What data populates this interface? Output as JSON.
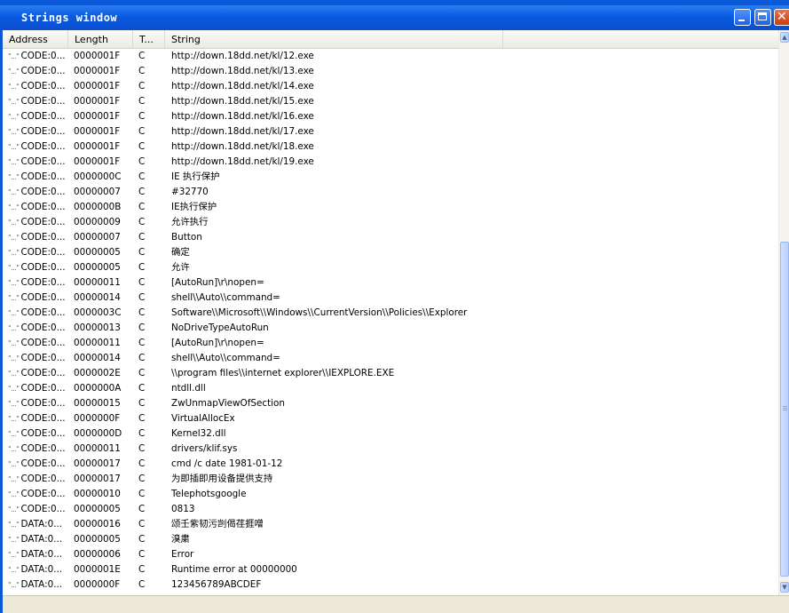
{
  "window": {
    "title": "Strings window"
  },
  "columns": [
    "Address",
    "Length",
    "T...",
    "String"
  ],
  "rows": [
    {
      "icon": "\"...\"",
      "address": "CODE:0...",
      "length": "0000001F",
      "type": "C",
      "string": "http://down.18dd.net/kl/12.exe"
    },
    {
      "icon": "\"...\"",
      "address": "CODE:0...",
      "length": "0000001F",
      "type": "C",
      "string": "http://down.18dd.net/kl/13.exe"
    },
    {
      "icon": "\"...\"",
      "address": "CODE:0...",
      "length": "0000001F",
      "type": "C",
      "string": "http://down.18dd.net/kl/14.exe"
    },
    {
      "icon": "\"...\"",
      "address": "CODE:0...",
      "length": "0000001F",
      "type": "C",
      "string": "http://down.18dd.net/kl/15.exe"
    },
    {
      "icon": "\"...\"",
      "address": "CODE:0...",
      "length": "0000001F",
      "type": "C",
      "string": "http://down.18dd.net/kl/16.exe"
    },
    {
      "icon": "\"...\"",
      "address": "CODE:0...",
      "length": "0000001F",
      "type": "C",
      "string": "http://down.18dd.net/kl/17.exe"
    },
    {
      "icon": "\"...\"",
      "address": "CODE:0...",
      "length": "0000001F",
      "type": "C",
      "string": "http://down.18dd.net/kl/18.exe"
    },
    {
      "icon": "\"...\"",
      "address": "CODE:0...",
      "length": "0000001F",
      "type": "C",
      "string": "http://down.18dd.net/kl/19.exe"
    },
    {
      "icon": "\"...\"",
      "address": "CODE:0...",
      "length": "0000000C",
      "type": "C",
      "string": "IE 执行保护"
    },
    {
      "icon": "\"...\"",
      "address": "CODE:0...",
      "length": "00000007",
      "type": "C",
      "string": "#32770"
    },
    {
      "icon": "\"...\"",
      "address": "CODE:0...",
      "length": "0000000B",
      "type": "C",
      "string": "IE执行保护"
    },
    {
      "icon": "\"...\"",
      "address": "CODE:0...",
      "length": "00000009",
      "type": "C",
      "string": "允许执行"
    },
    {
      "icon": "\"...\"",
      "address": "CODE:0...",
      "length": "00000007",
      "type": "C",
      "string": "Button"
    },
    {
      "icon": "\"...\"",
      "address": "CODE:0...",
      "length": "00000005",
      "type": "C",
      "string": "确定"
    },
    {
      "icon": "\"...\"",
      "address": "CODE:0...",
      "length": "00000005",
      "type": "C",
      "string": "允许"
    },
    {
      "icon": "\"...\"",
      "address": "CODE:0...",
      "length": "00000011",
      "type": "C",
      "string": "[AutoRun]\\r\\nopen="
    },
    {
      "icon": "\"...\"",
      "address": "CODE:0...",
      "length": "00000014",
      "type": "C",
      "string": "shell\\\\Auto\\\\command="
    },
    {
      "icon": "\"...\"",
      "address": "CODE:0...",
      "length": "0000003C",
      "type": "C",
      "string": "Software\\\\Microsoft\\\\Windows\\\\CurrentVersion\\\\Policies\\\\Explorer"
    },
    {
      "icon": "\"...\"",
      "address": "CODE:0...",
      "length": "00000013",
      "type": "C",
      "string": "NoDriveTypeAutoRun"
    },
    {
      "icon": "\"...\"",
      "address": "CODE:0...",
      "length": "00000011",
      "type": "C",
      "string": "[AutoRun]\\r\\nopen="
    },
    {
      "icon": "\"...\"",
      "address": "CODE:0...",
      "length": "00000014",
      "type": "C",
      "string": "shell\\\\Auto\\\\command="
    },
    {
      "icon": "\"...\"",
      "address": "CODE:0...",
      "length": "0000002E",
      "type": "C",
      "string": "\\\\program files\\\\internet explorer\\\\IEXPLORE.EXE"
    },
    {
      "icon": "\"...\"",
      "address": "CODE:0...",
      "length": "0000000A",
      "type": "C",
      "string": "ntdll.dll"
    },
    {
      "icon": "\"...\"",
      "address": "CODE:0...",
      "length": "00000015",
      "type": "C",
      "string": "ZwUnmapViewOfSection"
    },
    {
      "icon": "\"...\"",
      "address": "CODE:0...",
      "length": "0000000F",
      "type": "C",
      "string": "VirtualAllocEx"
    },
    {
      "icon": "\"...\"",
      "address": "CODE:0...",
      "length": "0000000D",
      "type": "C",
      "string": "Kernel32.dll"
    },
    {
      "icon": "\"...\"",
      "address": "CODE:0...",
      "length": "00000011",
      "type": "C",
      "string": "drivers/klif.sys"
    },
    {
      "icon": "\"...\"",
      "address": "CODE:0...",
      "length": "00000017",
      "type": "C",
      "string": "cmd /c date 1981-01-12"
    },
    {
      "icon": "\"...\"",
      "address": "CODE:0...",
      "length": "00000017",
      "type": "C",
      "string": "为即插即用设备提供支持"
    },
    {
      "icon": "\"...\"",
      "address": "CODE:0...",
      "length": "00000010",
      "type": "C",
      "string": "Telephotsgoogle"
    },
    {
      "icon": "\"...\"",
      "address": "CODE:0...",
      "length": "00000005",
      "type": "C",
      "string": "0813"
    },
    {
      "icon": "\"...\"",
      "address": "DATA:0...",
      "length": "00000016",
      "type": "C",
      "string": "颂壬紫韧污剀偈荏捱噌"
    },
    {
      "icon": "\"...\"",
      "address": "DATA:0...",
      "length": "00000005",
      "type": "C",
      "string": "溴粛"
    },
    {
      "icon": "\"...\"",
      "address": "DATA:0...",
      "length": "00000006",
      "type": "C",
      "string": "Error"
    },
    {
      "icon": "\"...\"",
      "address": "DATA:0...",
      "length": "0000001E",
      "type": "C",
      "string": "Runtime error     at 00000000"
    },
    {
      "icon": "\"...\"",
      "address": "DATA:0...",
      "length": "0000000F",
      "type": "C",
      "string": "123456789ABCDEF"
    }
  ],
  "scrollbar": {
    "position": 0.45
  }
}
